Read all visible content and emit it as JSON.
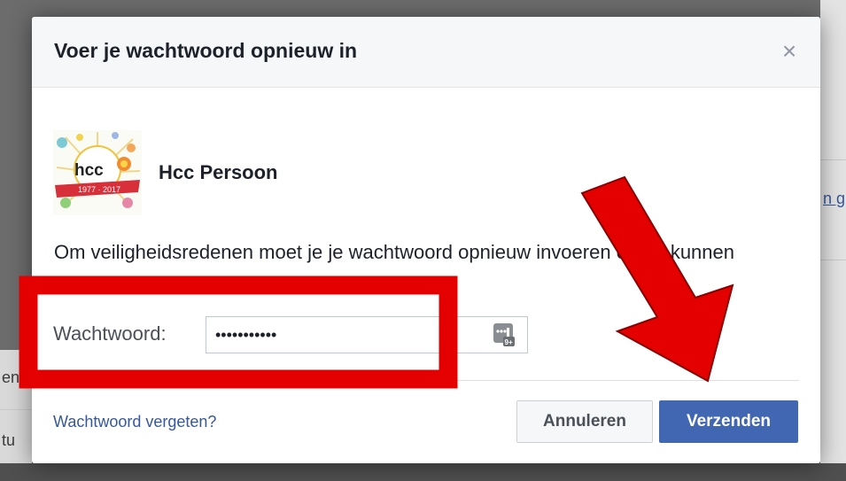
{
  "background": {
    "right_link_text": "n g",
    "left_text_1": "en",
    "left_text_2": "tu"
  },
  "dialog": {
    "title": "Voer je wachtwoord opnieuw in",
    "close_symbol": "×",
    "user": {
      "name": "Hcc Persoon",
      "avatar_text": "hcc",
      "avatar_banner_text": "1977 · 2017"
    },
    "message": "Om veiligheidsredenen moet je je wachtwoord opnieuw invoeren om te kunnen doorgaan.",
    "password": {
      "label": "Wachtwoord:",
      "value": "•••••••••••",
      "manager_icon": "password-manager-icon",
      "manager_badge": "9+"
    },
    "forgot_link": "Wachtwoord vergeten?",
    "cancel_label": "Annuleren",
    "submit_label": "Verzenden"
  },
  "annotations": {
    "highlight_color": "#e50000",
    "arrow_color": "#e50000"
  }
}
